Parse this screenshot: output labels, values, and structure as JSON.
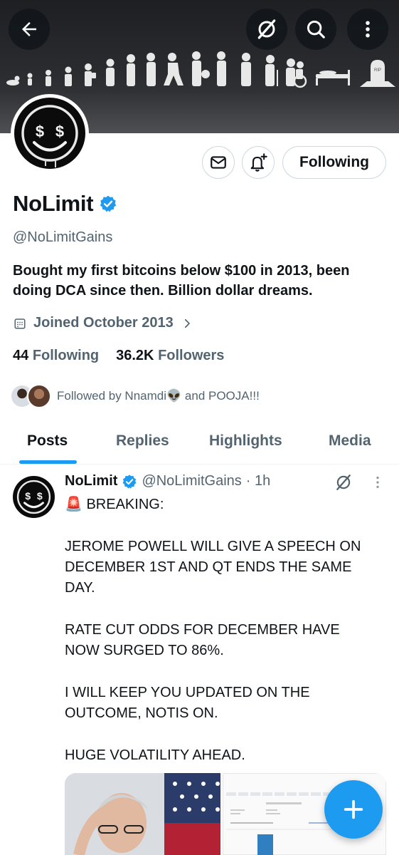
{
  "profile": {
    "name": "NoLimit",
    "handle": "@NoLimitGains",
    "bio": "Bought my first bitcoins below $100 in 2013, been doing DCA since then. Billion dollar dreams.",
    "joined": "Joined October 2013",
    "following_count": "44",
    "following_label": "Following",
    "followers_count": "36.2K",
    "followers_label": "Followers",
    "followed_by": "Followed by Nnamdi",
    "followed_by_emoji": "👽",
    "followed_by_rest": " and POOJA!!!",
    "follow_button": "Following",
    "avatar_text": "$ $"
  },
  "header_icons": [
    "back-arrow-icon",
    "grok-icon",
    "search-icon",
    "more-vertical-icon"
  ],
  "banner": {
    "tombstone_text": "RIP"
  },
  "tabs": [
    {
      "label": "Posts",
      "active": true
    },
    {
      "label": "Replies",
      "active": false
    },
    {
      "label": "Highlights",
      "active": false
    },
    {
      "label": "Media",
      "active": false
    }
  ],
  "post": {
    "author": "NoLimit",
    "handle": "@NoLimitGains",
    "time": "· 1h",
    "line1": "🚨 BREAKING:",
    "para1": "JEROME POWELL WILL GIVE A SPEECH ON DECEMBER 1ST AND QT ENDS THE SAME DAY.",
    "para2": "RATE CUT ODDS FOR DECEMBER HAVE NOW SURGED TO 86%.",
    "para3": "I WILL KEEP YOU UPDATED ON THE OUTCOME, NOTIS ON.",
    "para4": "HUGE VOLATILITY AHEAD."
  },
  "colors": {
    "accent": "#1d9bf0",
    "text": "#0f1419",
    "muted": "#536471",
    "border": "#cfd9de"
  }
}
